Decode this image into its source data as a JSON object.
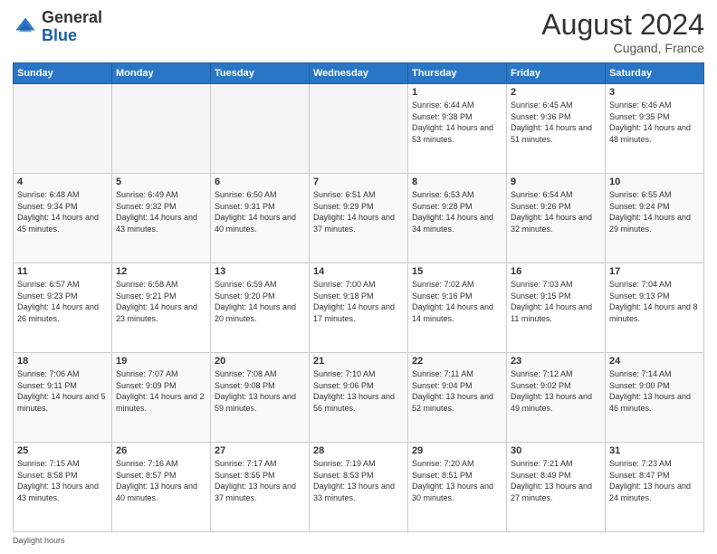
{
  "logo": {
    "general": "General",
    "blue": "Blue"
  },
  "header": {
    "month_year": "August 2024",
    "location": "Cugand, France"
  },
  "weekdays": [
    "Sunday",
    "Monday",
    "Tuesday",
    "Wednesday",
    "Thursday",
    "Friday",
    "Saturday"
  ],
  "weeks": [
    [
      {
        "day": "",
        "empty": true
      },
      {
        "day": "",
        "empty": true
      },
      {
        "day": "",
        "empty": true
      },
      {
        "day": "",
        "empty": true
      },
      {
        "day": "1",
        "sunrise": "6:44 AM",
        "sunset": "9:38 PM",
        "daylight": "14 hours and 53 minutes."
      },
      {
        "day": "2",
        "sunrise": "6:45 AM",
        "sunset": "9:36 PM",
        "daylight": "14 hours and 51 minutes."
      },
      {
        "day": "3",
        "sunrise": "6:46 AM",
        "sunset": "9:35 PM",
        "daylight": "14 hours and 48 minutes."
      }
    ],
    [
      {
        "day": "4",
        "sunrise": "6:48 AM",
        "sunset": "9:34 PM",
        "daylight": "14 hours and 45 minutes."
      },
      {
        "day": "5",
        "sunrise": "6:49 AM",
        "sunset": "9:32 PM",
        "daylight": "14 hours and 43 minutes."
      },
      {
        "day": "6",
        "sunrise": "6:50 AM",
        "sunset": "9:31 PM",
        "daylight": "14 hours and 40 minutes."
      },
      {
        "day": "7",
        "sunrise": "6:51 AM",
        "sunset": "9:29 PM",
        "daylight": "14 hours and 37 minutes."
      },
      {
        "day": "8",
        "sunrise": "6:53 AM",
        "sunset": "9:28 PM",
        "daylight": "14 hours and 34 minutes."
      },
      {
        "day": "9",
        "sunrise": "6:54 AM",
        "sunset": "9:26 PM",
        "daylight": "14 hours and 32 minutes."
      },
      {
        "day": "10",
        "sunrise": "6:55 AM",
        "sunset": "9:24 PM",
        "daylight": "14 hours and 29 minutes."
      }
    ],
    [
      {
        "day": "11",
        "sunrise": "6:57 AM",
        "sunset": "9:23 PM",
        "daylight": "14 hours and 26 minutes."
      },
      {
        "day": "12",
        "sunrise": "6:58 AM",
        "sunset": "9:21 PM",
        "daylight": "14 hours and 23 minutes."
      },
      {
        "day": "13",
        "sunrise": "6:59 AM",
        "sunset": "9:20 PM",
        "daylight": "14 hours and 20 minutes."
      },
      {
        "day": "14",
        "sunrise": "7:00 AM",
        "sunset": "9:18 PM",
        "daylight": "14 hours and 17 minutes."
      },
      {
        "day": "15",
        "sunrise": "7:02 AM",
        "sunset": "9:16 PM",
        "daylight": "14 hours and 14 minutes."
      },
      {
        "day": "16",
        "sunrise": "7:03 AM",
        "sunset": "9:15 PM",
        "daylight": "14 hours and 11 minutes."
      },
      {
        "day": "17",
        "sunrise": "7:04 AM",
        "sunset": "9:13 PM",
        "daylight": "14 hours and 8 minutes."
      }
    ],
    [
      {
        "day": "18",
        "sunrise": "7:06 AM",
        "sunset": "9:11 PM",
        "daylight": "14 hours and 5 minutes."
      },
      {
        "day": "19",
        "sunrise": "7:07 AM",
        "sunset": "9:09 PM",
        "daylight": "14 hours and 2 minutes."
      },
      {
        "day": "20",
        "sunrise": "7:08 AM",
        "sunset": "9:08 PM",
        "daylight": "13 hours and 59 minutes."
      },
      {
        "day": "21",
        "sunrise": "7:10 AM",
        "sunset": "9:06 PM",
        "daylight": "13 hours and 56 minutes."
      },
      {
        "day": "22",
        "sunrise": "7:11 AM",
        "sunset": "9:04 PM",
        "daylight": "13 hours and 52 minutes."
      },
      {
        "day": "23",
        "sunrise": "7:12 AM",
        "sunset": "9:02 PM",
        "daylight": "13 hours and 49 minutes."
      },
      {
        "day": "24",
        "sunrise": "7:14 AM",
        "sunset": "9:00 PM",
        "daylight": "13 hours and 46 minutes."
      }
    ],
    [
      {
        "day": "25",
        "sunrise": "7:15 AM",
        "sunset": "8:58 PM",
        "daylight": "13 hours and 43 minutes."
      },
      {
        "day": "26",
        "sunrise": "7:16 AM",
        "sunset": "8:57 PM",
        "daylight": "13 hours and 40 minutes."
      },
      {
        "day": "27",
        "sunrise": "7:17 AM",
        "sunset": "8:55 PM",
        "daylight": "13 hours and 37 minutes."
      },
      {
        "day": "28",
        "sunrise": "7:19 AM",
        "sunset": "8:53 PM",
        "daylight": "13 hours and 33 minutes."
      },
      {
        "day": "29",
        "sunrise": "7:20 AM",
        "sunset": "8:51 PM",
        "daylight": "13 hours and 30 minutes."
      },
      {
        "day": "30",
        "sunrise": "7:21 AM",
        "sunset": "8:49 PM",
        "daylight": "13 hours and 27 minutes."
      },
      {
        "day": "31",
        "sunrise": "7:23 AM",
        "sunset": "8:47 PM",
        "daylight": "13 hours and 24 minutes."
      }
    ]
  ],
  "footer": {
    "daylight_hours": "Daylight hours"
  }
}
